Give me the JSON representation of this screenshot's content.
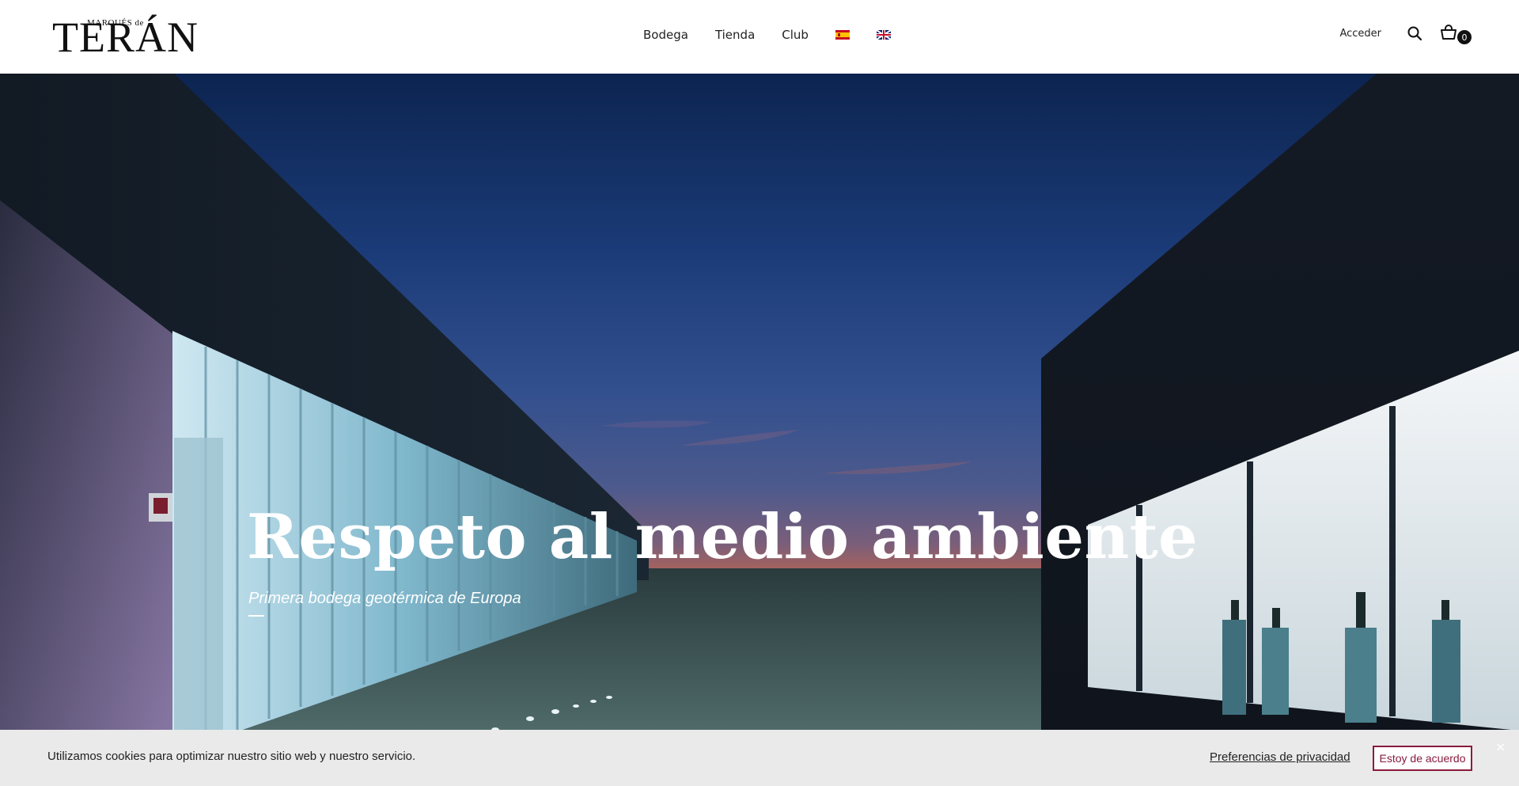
{
  "brand": {
    "logo_small": "MARQUÉS de",
    "logo_main": "TERÁN"
  },
  "nav": {
    "items": [
      {
        "label": "Bodega"
      },
      {
        "label": "Tienda"
      },
      {
        "label": "Club"
      }
    ],
    "languages": [
      {
        "code": "es",
        "icon": "spain-flag-icon"
      },
      {
        "code": "en",
        "icon": "uk-flag-icon"
      }
    ]
  },
  "tools": {
    "login_label": "Acceder",
    "search_icon": "search-icon",
    "cart_icon": "shopping-basket-icon",
    "cart_count": "0"
  },
  "hero": {
    "title": "Respeto al medio ambiente",
    "subtitle": "Primera bodega geotérmica de Europa"
  },
  "cookie": {
    "message": "Utilizamos cookies para optimizar nuestro sitio web y nuestro servicio.",
    "preferences_label": "Preferencias de privacidad",
    "accept_label": "Estoy de acuerdo",
    "close_symbol": "×"
  },
  "colors": {
    "accent": "#8a1b3d",
    "header_bg": "#ffffff",
    "cookie_bg": "#eaeaea"
  }
}
